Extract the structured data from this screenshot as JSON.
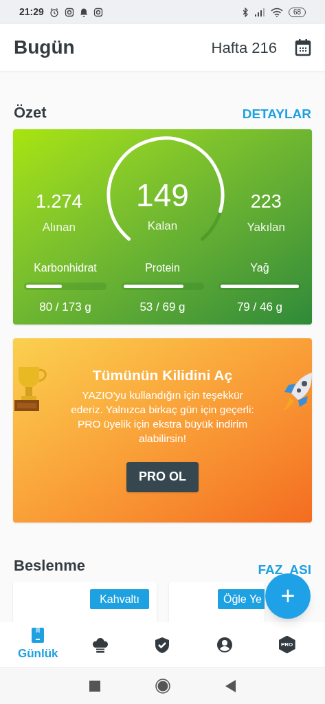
{
  "status_bar": {
    "time": "21:29",
    "battery": "68"
  },
  "header": {
    "title": "Bugün",
    "week": "Hafta 216"
  },
  "summary": {
    "title": "Özet",
    "action": "DETAYLAR",
    "eaten": {
      "value": "1.274",
      "label": "Alınan"
    },
    "remaining": {
      "value": "149",
      "label": "Kalan"
    },
    "burned": {
      "value": "223",
      "label": "Yakılan"
    },
    "macros": [
      {
        "name": "Karbonhidrat",
        "level": 0.46,
        "reading": "80 / 173 g"
      },
      {
        "name": "Protein",
        "level": 0.77,
        "reading": "53 / 69 g"
      },
      {
        "name": "Yağ",
        "level": 1,
        "reading": "79 / 46 g"
      }
    ]
  },
  "promo": {
    "title": "Tümünün Kilidini Aç",
    "text": "YAZIO'yu kullandığın için teşekkür ederiz. Yalnızca birkaç gün için geçerli: PRO üyelik için ekstra büyük indirim alabilirsin!",
    "button": "PRO OL"
  },
  "nutrition": {
    "title": "Beslenme",
    "action_parts": [
      "FAZ",
      "ASI"
    ],
    "meals": [
      {
        "label": "Kahvaltı"
      },
      {
        "label": "Öğle Ye"
      }
    ]
  },
  "fab": {
    "label": "+"
  },
  "bottom_nav": [
    {
      "kind": "diary",
      "label": "Günlük",
      "selected": true
    },
    {
      "kind": "recipes",
      "selected": false
    },
    {
      "kind": "fasting",
      "selected": false
    },
    {
      "kind": "profile",
      "selected": false
    },
    {
      "kind": "pro",
      "badge": "PRO",
      "selected": false
    }
  ]
}
